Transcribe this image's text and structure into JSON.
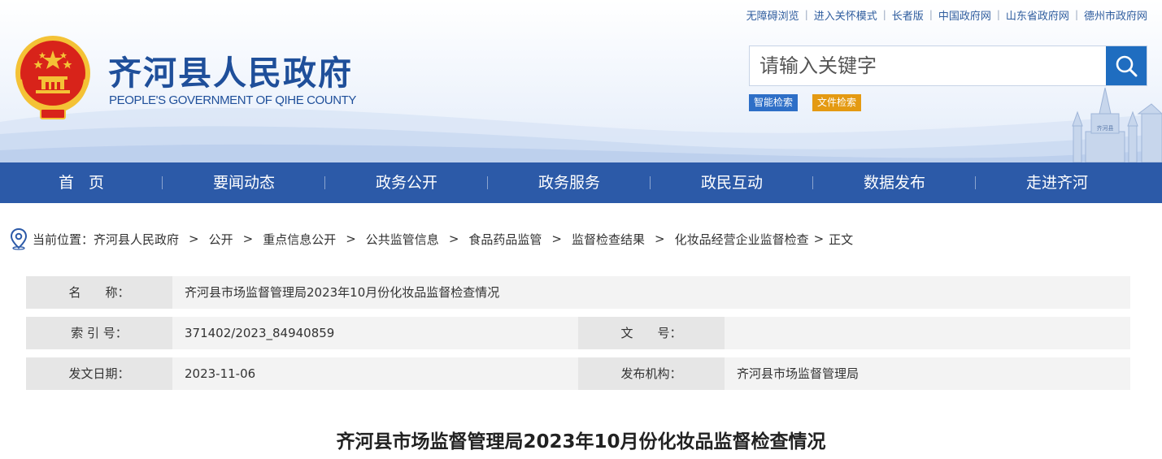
{
  "top_links": [
    "无障碍浏览",
    "进入关怀模式",
    "长者版",
    "中国政府网",
    "山东省政府网",
    "德州市政府网"
  ],
  "site": {
    "title": "齐河县人民政府",
    "subtitle": "PEOPLE'S GOVERNMENT OF QIHE COUNTY",
    "tower_caption": "齐河县"
  },
  "search": {
    "placeholder": "请输入关键字",
    "value": "",
    "smart_label": "智能检索",
    "file_label": "文件检索"
  },
  "nav": [
    "首页",
    "要闻动态",
    "政务公开",
    "政务服务",
    "政民互动",
    "数据发布",
    "走进齐河"
  ],
  "breadcrumb": {
    "prefix": "当前位置：",
    "items": [
      "齐河县人民政府",
      "公开",
      "重点信息公开",
      "公共监管信息",
      "食品药品监管",
      "监督检查结果",
      "化妆品经营企业监督检查"
    ],
    "current": "正文"
  },
  "meta": {
    "name_label": "名　　称：",
    "name_value": "齐河县市场监督管理局2023年10月份化妆品监督检查情况",
    "index_label": "索 引 号：",
    "index_value": "371402/2023_84940859",
    "doc_no_label": "文　　号：",
    "doc_no_value": "",
    "date_label": "发文日期：",
    "date_value": "2023-11-06",
    "org_label": "发布机构：",
    "org_value": "齐河县市场监督管理局"
  },
  "article": {
    "title": "齐河县市场监督管理局2023年10月份化妆品监督检查情况"
  },
  "colors": {
    "brand_blue": "#1f4f9a",
    "nav_bg": "#2c5aa8",
    "search_btn": "#1f6dc0",
    "tag_smart": "#2e6fc7",
    "tag_file": "#e49a12",
    "emblem_red": "#d8231a",
    "emblem_gold": "#f4c236"
  }
}
